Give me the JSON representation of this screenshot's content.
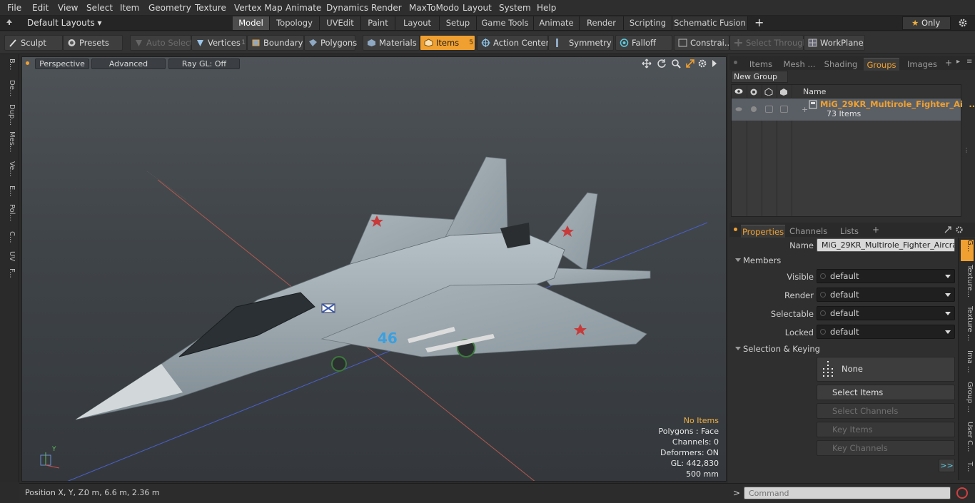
{
  "menubar": {
    "items": [
      "File",
      "Edit",
      "View",
      "Select",
      "Item",
      "Geometry",
      "Texture",
      "Vertex Map",
      "Animate",
      "Dynamics",
      "Render",
      "MaxToModo",
      "Layout",
      "System",
      "Help"
    ]
  },
  "tabbar": {
    "layout_dropdown": "Default Layouts",
    "tabs": [
      "Model",
      "Topology",
      "UVEdit",
      "Paint",
      "Layout",
      "Setup",
      "Game Tools",
      "Animate",
      "Render",
      "Scripting",
      "Schematic Fusion"
    ],
    "active_tab": "Model",
    "add_label": "+",
    "only_label": "Only",
    "gear_icon": "gear-icon"
  },
  "toolbar": {
    "sculpt": "Sculpt",
    "presets": "Presets",
    "auto_select": "Auto Select",
    "vertices": "Vertices",
    "vertices_count": "1",
    "boundary": "Boundary",
    "polygons": "Polygons",
    "materials": "Materials",
    "items": "Items",
    "items_count": "5",
    "action_center": "Action Center",
    "symmetry": "Symmetry",
    "falloff": "Falloff",
    "constraints": "Constrai...",
    "select_through": "Select Through",
    "workplane": "WorkPlane",
    "accent_color": "#f0a030"
  },
  "left_tabs": [
    "B...",
    "De...",
    "Dup...",
    "Mes...",
    "Ve...",
    "E...",
    "Pol...",
    "C...",
    "UV",
    "F..."
  ],
  "viewport": {
    "view_mode": "Perspective",
    "shading": "Advanced",
    "raygl": "Ray GL: Off",
    "info": {
      "no_items": "No Items",
      "polygons": "Polygons : Face",
      "channels": "Channels: 0",
      "deformers": "Deformers: ON",
      "gl": "GL: 442,830",
      "grid": "500 mm"
    },
    "axis_y": "Y",
    "aircraft_number": "46",
    "no_items_color": "#f0b040"
  },
  "statusbar": {
    "position_label": "Position X, Y, Z:",
    "position_value": "0 m, 6.6 m, 2.36 m"
  },
  "groups_panel": {
    "tabs": [
      "Items",
      "Mesh ...",
      "Shading",
      "Groups",
      "Images"
    ],
    "active_tab": "Groups",
    "new_group": "New Group",
    "column_name": "Name",
    "group_name": "MiG_29KR_Multirole_Fighter_Ai ...",
    "group_count": "73 Items"
  },
  "properties_panel": {
    "tabs": [
      "Properties",
      "Channels",
      "Lists"
    ],
    "active_tab": "Properties",
    "name_label": "Name",
    "name_value": "MiG_29KR_Multirole_Fighter_Aircraft_",
    "members_section": "Members",
    "rows": [
      {
        "label": "Visible",
        "value": "default"
      },
      {
        "label": "Render",
        "value": "default"
      },
      {
        "label": "Selectable",
        "value": "default"
      },
      {
        "label": "Locked",
        "value": "default"
      }
    ],
    "selection_section": "Selection & Keying",
    "none_button": "None",
    "select_items": "Select Items",
    "select_channels": "Select Channels",
    "key_items": "Key Items",
    "key_channels": "Key Channels",
    "more": ">>",
    "side_tabs": [
      "G...",
      "Texture...",
      "Texture ...",
      "Ima ...",
      "Group ...",
      "User C...",
      "T..."
    ]
  },
  "command": {
    "prompt": ">",
    "placeholder": "Command"
  }
}
